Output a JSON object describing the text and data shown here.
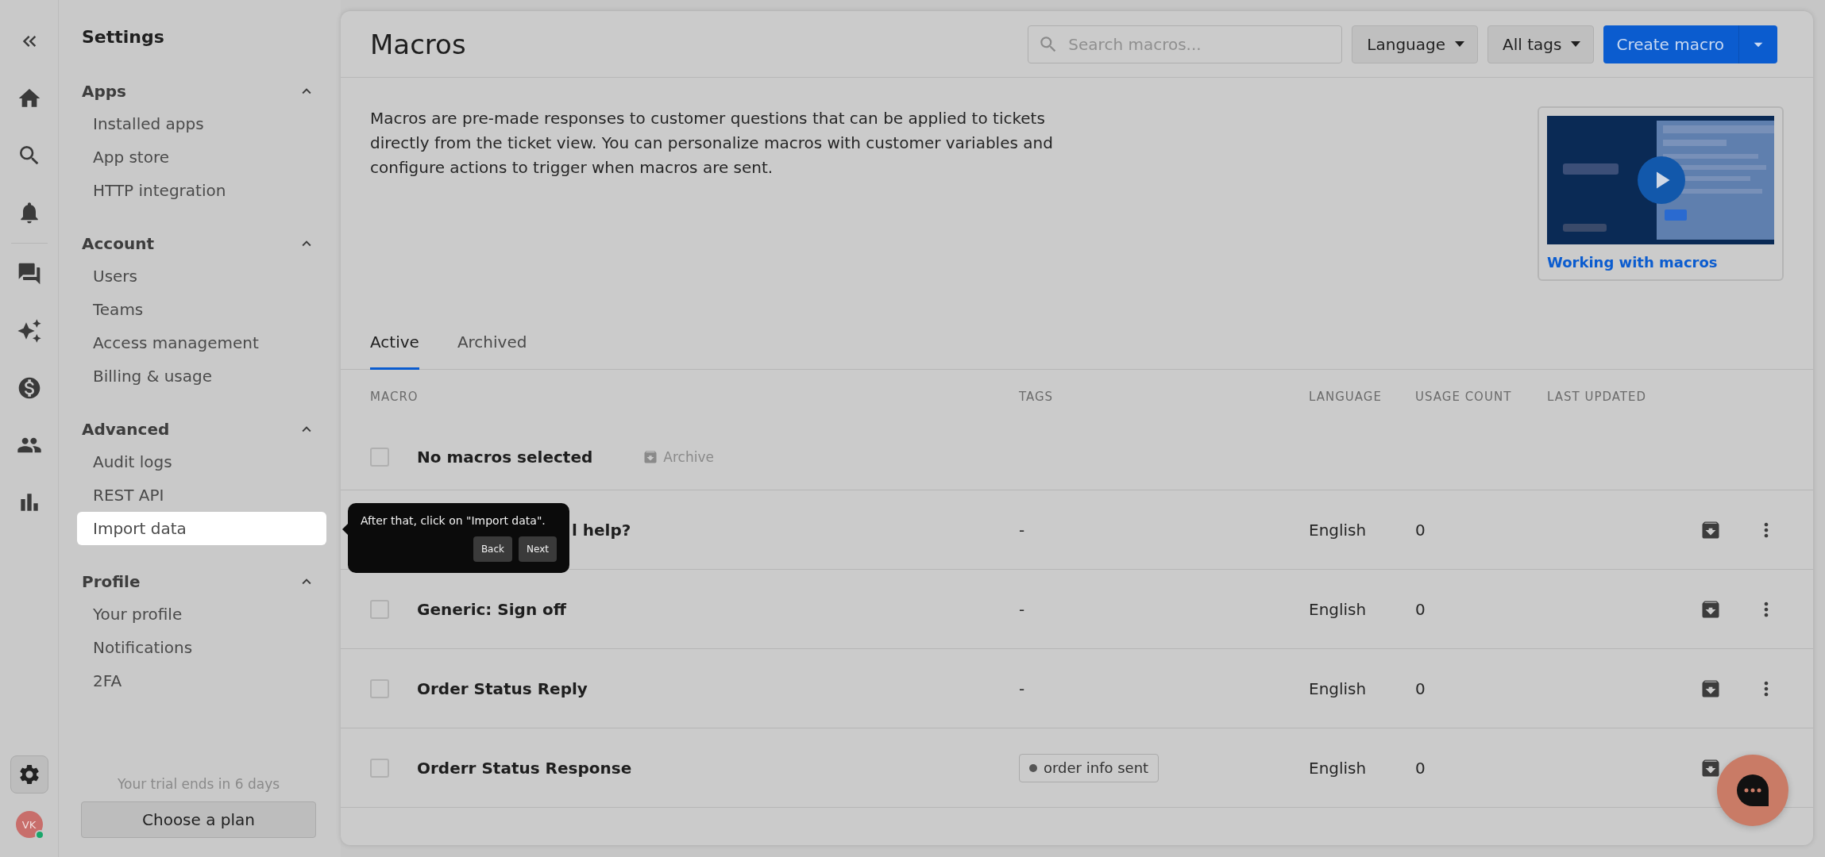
{
  "rail": {
    "items": [
      {
        "kind": "home"
      },
      {
        "kind": "search"
      },
      {
        "kind": "bell"
      },
      {
        "kind": "chat"
      },
      {
        "kind": "sparkles"
      },
      {
        "kind": "dollar"
      },
      {
        "kind": "people"
      },
      {
        "kind": "chart"
      }
    ],
    "settings_selected": true,
    "avatar": {
      "initials": "VK",
      "online": true
    }
  },
  "sidebar": {
    "title": "Settings",
    "sections": [
      {
        "title": "Apps",
        "expanded": true,
        "items": [
          {
            "label": "Installed apps",
            "highlighted": false
          },
          {
            "label": "App store",
            "highlighted": false
          },
          {
            "label": "HTTP integration",
            "highlighted": false
          }
        ]
      },
      {
        "title": "Account",
        "expanded": true,
        "items": [
          {
            "label": "Users",
            "highlighted": false
          },
          {
            "label": "Teams",
            "highlighted": false
          },
          {
            "label": "Access management",
            "highlighted": false
          },
          {
            "label": "Billing & usage",
            "highlighted": false
          }
        ]
      },
      {
        "title": "Advanced",
        "expanded": true,
        "items": [
          {
            "label": "Audit logs",
            "highlighted": false
          },
          {
            "label": "REST API",
            "highlighted": false
          },
          {
            "label": "Import data",
            "highlighted": true
          }
        ]
      },
      {
        "title": "Profile",
        "expanded": true,
        "items": [
          {
            "label": "Your profile",
            "highlighted": false
          },
          {
            "label": "Notifications",
            "highlighted": false
          },
          {
            "label": "2FA",
            "highlighted": false
          }
        ]
      }
    ],
    "trial": "Your trial ends in 6 days",
    "plan_button": "Choose a plan"
  },
  "header": {
    "title": "Macros",
    "search": {
      "placeholder": "Search macros..."
    },
    "filters": [
      "Language",
      "All tags"
    ],
    "create_button": "Create macro"
  },
  "intro": {
    "text": "Macros are pre-made responses to customer questions that can be applied to tickets directly from the ticket view. You can personalize macros with customer variables and configure actions to trigger when macros are sent.",
    "video": {
      "kind": "picture",
      "link": "Working with macros"
    }
  },
  "tabs": [
    {
      "label": "Active",
      "selected": true
    },
    {
      "label": "Archived",
      "selected": false
    }
  ],
  "table": {
    "columns": [
      "MACRO",
      "TAGS",
      "LANGUAGE",
      "USAGE COUNT",
      "LAST UPDATED"
    ],
    "selection": {
      "label": "No macros selected",
      "checked": false,
      "archive": {
        "label": "Archive",
        "disabled": true
      }
    },
    "rows": [
      {
        "name": "l help?",
        "covered": true,
        "more_visible": true,
        "tags_text": "-",
        "language": "English",
        "usage": "0"
      },
      {
        "name": "Generic: Sign off",
        "covered": false,
        "more_visible": true,
        "checked": false,
        "tags_text": "-",
        "language": "English",
        "usage": "0"
      },
      {
        "name": "Order Status Reply",
        "covered": false,
        "more_visible": true,
        "checked": false,
        "tags_text": "-",
        "language": "English",
        "usage": "0"
      },
      {
        "name": "Orderr Status Response",
        "covered": false,
        "more_visible": false,
        "checked": false,
        "tags": [
          {
            "label": "order info sent"
          }
        ],
        "language": "English",
        "usage": "0"
      }
    ]
  },
  "tour": {
    "text": "After that, click on \"Import data\".",
    "buttons": [
      "Back",
      "Next"
    ]
  }
}
